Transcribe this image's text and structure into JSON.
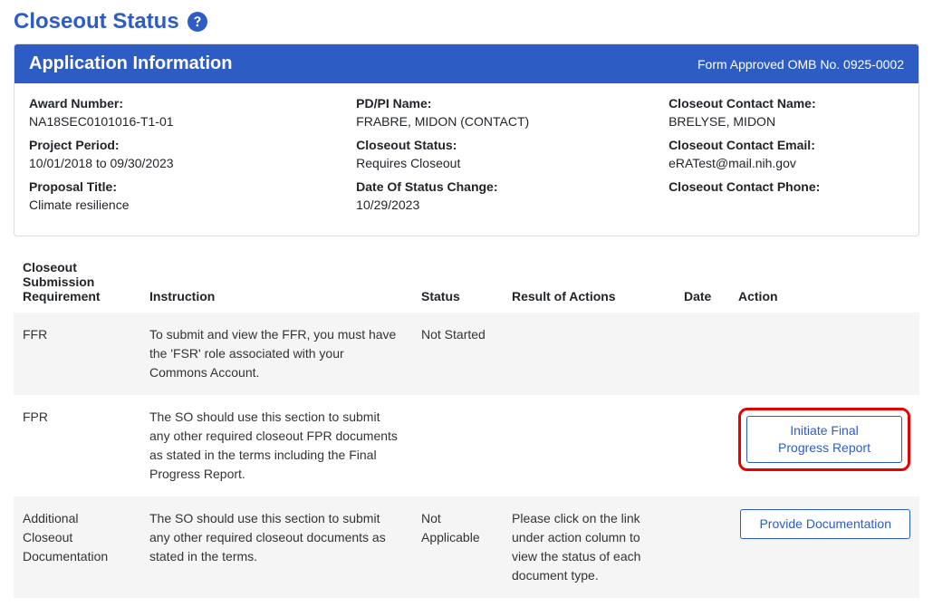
{
  "page": {
    "title": "Closeout Status"
  },
  "card": {
    "header_title": "Application Information",
    "header_right": "Form Approved OMB No. 0925-0002"
  },
  "info": {
    "award_number_label": "Award Number:",
    "award_number_value": "NA18SEC0101016-T1-01",
    "project_period_label": "Project Period:",
    "project_period_value": "10/01/2018 to 09/30/2023",
    "proposal_title_label": "Proposal Title:",
    "proposal_title_value": "Climate resilience",
    "pdpi_name_label": "PD/PI Name:",
    "pdpi_name_value": "FRABRE, MIDON (CONTACT)",
    "closeout_status_label": "Closeout Status:",
    "closeout_status_value": "Requires Closeout",
    "date_status_change_label": "Date Of Status Change:",
    "date_status_change_value": "10/29/2023",
    "contact_name_label": "Closeout Contact Name:",
    "contact_name_value": "BRELYSE, MIDON",
    "contact_email_label": "Closeout Contact Email:",
    "contact_email_value": "eRATest@mail.nih.gov",
    "contact_phone_label": "Closeout Contact Phone:",
    "contact_phone_value": ""
  },
  "table": {
    "headers": {
      "requirement": "Closeout Submission Requirement",
      "instruction": "Instruction",
      "status": "Status",
      "result": "Result of Actions",
      "date": "Date",
      "action": "Action"
    },
    "rows": [
      {
        "requirement": "FFR",
        "instruction": "To submit and view the FFR, you must have the 'FSR' role associated with your Commons Account.",
        "status": "Not Started",
        "result": "",
        "date": "",
        "action_label": ""
      },
      {
        "requirement": "FPR",
        "instruction": "The SO should use this section to submit any other required closeout FPR documents as stated in the terms including the Final Progress Report.",
        "status": "",
        "result": "",
        "date": "",
        "action_label": "Initiate Final Progress Report"
      },
      {
        "requirement": "Additional Closeout Documentation",
        "instruction": "The SO should use this section to submit any other required closeout documents as stated in the terms.",
        "status": "Not Applicable",
        "result": "Please click on the link under action column to view the status of each document type.",
        "date": "",
        "action_label": "Provide Documentation"
      }
    ]
  }
}
